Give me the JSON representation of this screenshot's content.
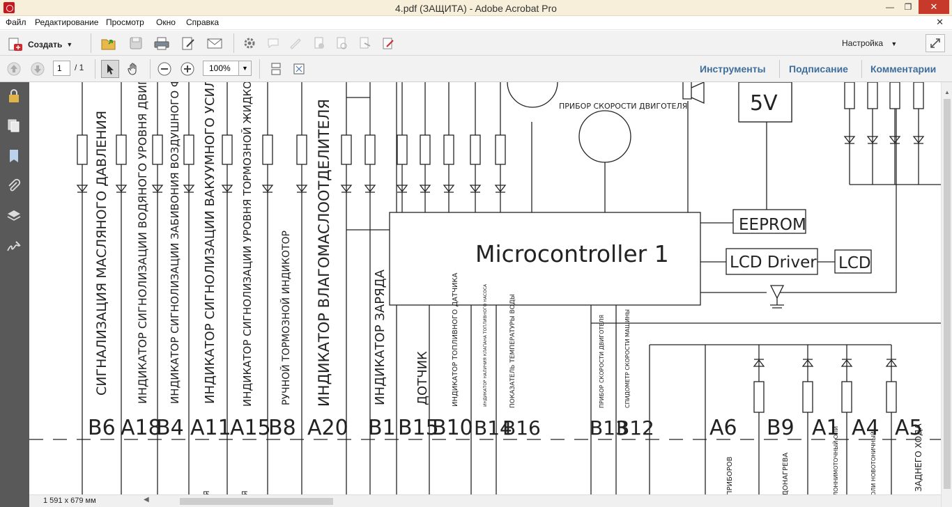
{
  "window": {
    "title": "4.pdf (ЗАЩИТА) - Adobe Acrobat Pro"
  },
  "menu": [
    "Файл",
    "Редактирование",
    "Просмотр",
    "Окно",
    "Справка"
  ],
  "toolbar": {
    "create_label": "Создать",
    "settings_label": "Настройка"
  },
  "nav": {
    "page_current": "1",
    "page_total": "/ 1",
    "zoom": "100%"
  },
  "panels": {
    "tools": "Инструменты",
    "sign": "Подписание",
    "comments": "Комментарии"
  },
  "status": {
    "dimensions": "1 591 x 679 мм"
  },
  "drawing": {
    "top_labels": {
      "motor_speed": "ПРИБОР СКОРОСТИ ДВИГОТЕЛЯ",
      "power": "5V"
    },
    "blocks": {
      "mcu": "Microcontroller 1",
      "eeprom": "EEPROM",
      "lcd_driver": "LCD Driver",
      "lcd": "LCD"
    },
    "signal_texts": [
      "СИГНАЛИЗАЦИЯ МАСЛЯНОГО ДАВЛЕНИЯ",
      "ИНДИКАТОР СИГНОЛИЗАЦИИ ВОДЯНОГО УРОВНЯ ДВИГ",
      "ИНДИКАТОР СИГНОЛИЗАЦИИ ЗАБИВОНИЯ ВОЗДУШНОГО ФИЛЬ",
      "ИНДИКАТОР СИГНОЛИЗАЦИИ ВАКУУМНОГО УСИЛИТ",
      "ИНДИКАТОР СИГНОЛИЗАЦИИ УРОВНЯ ТОРМОЗНОЙ ЖИДКОСТИ",
      "РУЧНОЙ ТОРМОЗНОЙ ИНДИКОТОР",
      "ИНДИКАТОР ВЛАГОМАСЛООТДЕЛИТЕЛЯ",
      "ИНДИКАТОР ЗАРЯДА",
      "ДОТЧИК",
      "ИНДИКАТОР ТОПЛИВНОГО ДАТЧИКА",
      "ИНДИКАТОР НАЛИЧИЯ КЛАПАНА ТОПЛИВНОГО НАСОСА",
      "ПОКАЗАТЕЛЬ ТЕМПЕРАТУРЫ ВОДЫ",
      "ПРИБОР СКОРОСТИ ДВИГОТЕЛЯ",
      "СПИДОМЕТР СКОРОСТИ МАШИНЫ"
    ],
    "pin_labels": [
      "B6",
      "A18",
      "B4",
      "A11",
      "A15",
      "B8",
      "A20",
      "B1",
      "B15",
      "B10",
      "B14",
      "B16",
      "B13",
      "B12",
      "A6",
      "B9",
      "A1",
      "A4",
      "A5"
    ],
    "bottom_fragments": [
      "Я",
      "Я",
      "ПРИБОРОВ",
      "ДОНАГРЕВА",
      "ЛОННИМОТОЧНЫЙ ОЛИ",
      "ОЛИ НОВОТОНИЧНЫЙ",
      "ЗАДНЕГО ХОДА"
    ]
  }
}
